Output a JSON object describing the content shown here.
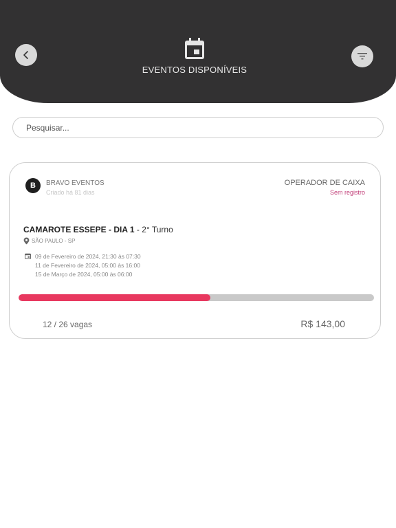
{
  "header": {
    "title": "EVENTOS DISPONÍVEIS",
    "back_icon": "chevron-left-icon",
    "calendar_icon": "calendar-icon",
    "filter_icon": "filter-icon",
    "background": "#323132"
  },
  "search": {
    "placeholder": "Pesquisar...",
    "value": ""
  },
  "event_card": {
    "organizer": {
      "avatar_letter": "B",
      "name": "BRAVO EVENTOS",
      "subtitle": "Criado há 81 dias"
    },
    "role": {
      "label": "OPERADOR DE CAIXA",
      "status": "Sem registro",
      "status_color": "#c2417a"
    },
    "title": "CAMAROTE ESSEPE - DIA 1",
    "separator": "-",
    "shift": "2° Turno",
    "location": "SÃO PAULO - SP",
    "dates": [
      "09 de Fevereiro de 2024, 21:30 às 07:30",
      "11 de Fevereiro de 2024, 05:00 às 16:00",
      "15 de Março de 2024, 05:00 às 06:00"
    ],
    "progress": {
      "fraction": 0.54,
      "fill_color": "#e8385f"
    },
    "vagas": "12 / 26 vagas",
    "price": "R$ 143,00"
  }
}
